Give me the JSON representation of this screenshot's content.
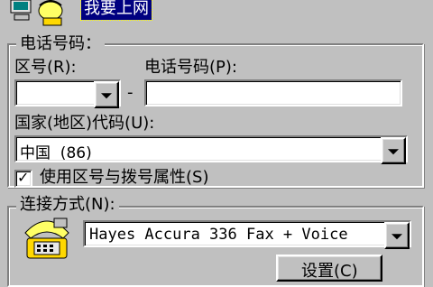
{
  "connection_name": "我要上网",
  "phone_group": {
    "legend": "电话号码：",
    "area_code_label": "区号(R):",
    "area_code_value": "",
    "dash": "-",
    "phone_number_label": "电话号码(P):",
    "phone_number_value": "",
    "country_label": "国家(地区)代码(U):",
    "country_value": "中国  (86)",
    "use_area_checkbox_label": "使用区号与拨号属性(S)",
    "use_area_checked": true
  },
  "connect_group": {
    "legend": "连接方式(N):",
    "modem_value": "Hayes Accura 336 Fax + Voice",
    "settings_button": "设置(C)"
  },
  "icons": {
    "top": "computer-phone-icon",
    "modem": "telephone-icon"
  }
}
